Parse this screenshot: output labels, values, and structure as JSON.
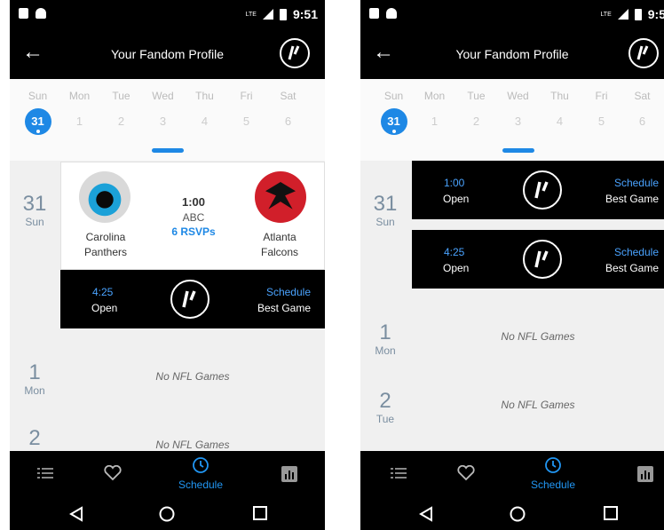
{
  "screens": [
    {
      "status_bar": {
        "network": "LTE",
        "time": "9:51"
      },
      "app_bar": {
        "back_icon": "back-arrow-icon",
        "title": "Your Fandom Profile",
        "logo_icon": "fandom-logo-icon"
      },
      "week": {
        "days": [
          {
            "name": "Sun",
            "num": "31",
            "active": true
          },
          {
            "name": "Mon",
            "num": "1"
          },
          {
            "name": "Tue",
            "num": "2"
          },
          {
            "name": "Wed",
            "num": "3"
          },
          {
            "name": "Thu",
            "num": "4"
          },
          {
            "name": "Fri",
            "num": "5"
          },
          {
            "name": "Sat",
            "num": "6"
          }
        ]
      },
      "schedule": {
        "day31": {
          "num": "31",
          "day": "Sun"
        },
        "game": {
          "home_team": "Carolina\nPanthers",
          "away_team": "Atlanta\nFalcons",
          "time": "1:00",
          "network": "ABC",
          "rsvps": "6  RSVPs"
        },
        "slot": {
          "time": "4:25",
          "status": "Open",
          "action": "Schedule",
          "sub": "Best Game"
        },
        "day1": {
          "num": "1",
          "day": "Mon",
          "message": "No NFL Games"
        },
        "day2": {
          "num": "2",
          "message": "No NFL Games"
        }
      },
      "bottom_nav": [
        {
          "icon": "list-icon"
        },
        {
          "icon": "heart-icon"
        },
        {
          "icon": "clock-icon",
          "label": "Schedule",
          "active": true
        },
        {
          "icon": "stats-icon"
        }
      ]
    },
    {
      "status_bar": {
        "network": "LTE",
        "time": "9:5"
      },
      "app_bar": {
        "back_icon": "back-arrow-icon",
        "title": "Your Fandom Profile",
        "logo_icon": "fandom-logo-icon"
      },
      "week": {
        "days": [
          {
            "name": "Sun",
            "num": "31",
            "active": true
          },
          {
            "name": "Mon",
            "num": "1"
          },
          {
            "name": "Tue",
            "num": "2"
          },
          {
            "name": "Wed",
            "num": "3"
          },
          {
            "name": "Thu",
            "num": "4"
          },
          {
            "name": "Fri",
            "num": "5"
          },
          {
            "name": "Sat",
            "num": "6"
          }
        ]
      },
      "schedule": {
        "day31": {
          "num": "31",
          "day": "Sun"
        },
        "slots": [
          {
            "time": "1:00",
            "status": "Open",
            "action": "Schedule",
            "sub": "Best Game"
          },
          {
            "time": "4:25",
            "status": "Open",
            "action": "Schedule",
            "sub": "Best Game"
          }
        ],
        "day1": {
          "num": "1",
          "day": "Mon",
          "message": "No NFL Games"
        },
        "day2": {
          "num": "2",
          "day": "Tue",
          "message": "No NFL Games"
        }
      },
      "bottom_nav": [
        {
          "icon": "list-icon"
        },
        {
          "icon": "heart-icon"
        },
        {
          "icon": "clock-icon",
          "label": "Schedule",
          "active": true
        },
        {
          "icon": "stats-icon"
        }
      ]
    }
  ],
  "colors": {
    "accent": "#1e88e5",
    "bar": "#000000",
    "date_label": "#7a8ea0"
  },
  "system_nav": {
    "back_icon": "back-triangle-icon",
    "home_icon": "home-circle-icon",
    "recents_icon": "recents-square-icon"
  }
}
